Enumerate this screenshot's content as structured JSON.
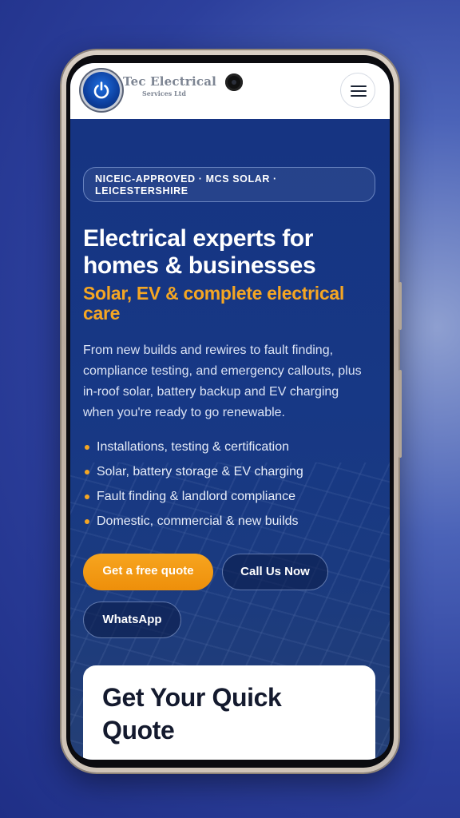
{
  "brand": {
    "name": "Tec Electrical",
    "tagline": "Services Ltd",
    "icon": "power-icon"
  },
  "header": {
    "menu_icon": "hamburger-menu-icon"
  },
  "hero": {
    "badge": "NICEIC-APPROVED · MCS SOLAR · LEICESTERSHIRE",
    "heading": "Electrical experts for homes & businesses",
    "subheading": "Solar, EV & complete electrical care",
    "intro": "From new builds and rewires to fault finding, compliance testing, and emergency callouts, plus in-roof solar, battery backup and EV charging when you're ready to go renewable.",
    "bullets": [
      "Installations, testing & certification",
      "Solar, battery storage & EV charging",
      "Fault finding & landlord compliance",
      "Domestic, commercial & new builds"
    ],
    "buttons": {
      "quote": "Get a free quote",
      "call": "Call Us Now",
      "whatsapp": "WhatsApp"
    }
  },
  "quote_card": {
    "title": "Get Your Quick Quote"
  },
  "colors": {
    "accent": "#f5a623",
    "hero_bg": "#163482",
    "header_bg": "#ffffff"
  }
}
